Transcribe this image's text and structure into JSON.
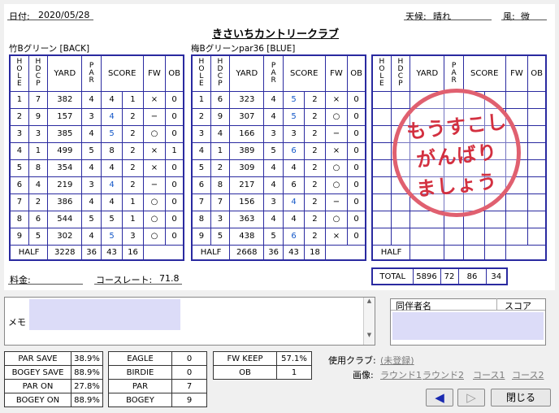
{
  "header": {
    "date_label": "日付:",
    "date_value": "2020/05/28",
    "title": "きさいちカントリークラブ",
    "weather_label": "天候:",
    "weather_value": "晴れ",
    "wind_label": "風:",
    "wind_value": "微"
  },
  "columns": {
    "hole": "HOLE",
    "hdcp": "HDCP",
    "yard": "YARD",
    "par": "PAR",
    "score": "SCORE",
    "fw": "FW",
    "ob": "OB"
  },
  "course1": {
    "name": "竹Bグリーン [BACK]",
    "rows": [
      {
        "hole": "1",
        "hdcp": "7",
        "yard": "382",
        "par": "4",
        "score": "4",
        "putt": "1",
        "fw": "×",
        "ob": "0",
        "style": ""
      },
      {
        "hole": "2",
        "hdcp": "9",
        "yard": "157",
        "par": "3",
        "score": "4",
        "putt": "2",
        "fw": "−",
        "ob": "0",
        "style": "blue"
      },
      {
        "hole": "3",
        "hdcp": "3",
        "yard": "385",
        "par": "4",
        "score": "5",
        "putt": "2",
        "fw": "○",
        "ob": "0",
        "style": "blue"
      },
      {
        "hole": "4",
        "hdcp": "1",
        "yard": "499",
        "par": "5",
        "score": "8",
        "putt": "2",
        "fw": "×",
        "ob": "1",
        "style": "bold"
      },
      {
        "hole": "5",
        "hdcp": "8",
        "yard": "354",
        "par": "4",
        "score": "4",
        "putt": "2",
        "fw": "×",
        "ob": "0",
        "style": ""
      },
      {
        "hole": "6",
        "hdcp": "4",
        "yard": "219",
        "par": "3",
        "score": "4",
        "putt": "2",
        "fw": "−",
        "ob": "0",
        "style": "blue"
      },
      {
        "hole": "7",
        "hdcp": "2",
        "yard": "386",
        "par": "4",
        "score": "4",
        "putt": "1",
        "fw": "○",
        "ob": "0",
        "style": ""
      },
      {
        "hole": "8",
        "hdcp": "6",
        "yard": "544",
        "par": "5",
        "score": "5",
        "putt": "1",
        "fw": "○",
        "ob": "0",
        "style": ""
      },
      {
        "hole": "9",
        "hdcp": "5",
        "yard": "302",
        "par": "4",
        "score": "5",
        "putt": "3",
        "fw": "○",
        "ob": "0",
        "style": "blue"
      }
    ],
    "half": {
      "label": "HALF",
      "yard": "3228",
      "par": "36",
      "score": "43",
      "putt": "16"
    }
  },
  "course2": {
    "name": "梅Bグリーンpar36 [BLUE]",
    "rows": [
      {
        "hole": "1",
        "hdcp": "6",
        "yard": "323",
        "par": "4",
        "score": "5",
        "putt": "2",
        "fw": "×",
        "ob": "0",
        "style": "blue"
      },
      {
        "hole": "2",
        "hdcp": "9",
        "yard": "307",
        "par": "4",
        "score": "5",
        "putt": "2",
        "fw": "○",
        "ob": "0",
        "style": "blue"
      },
      {
        "hole": "3",
        "hdcp": "4",
        "yard": "166",
        "par": "3",
        "score": "3",
        "putt": "2",
        "fw": "−",
        "ob": "0",
        "style": ""
      },
      {
        "hole": "4",
        "hdcp": "1",
        "yard": "389",
        "par": "5",
        "score": "6",
        "putt": "2",
        "fw": "×",
        "ob": "0",
        "style": "blue"
      },
      {
        "hole": "5",
        "hdcp": "2",
        "yard": "309",
        "par": "4",
        "score": "4",
        "putt": "2",
        "fw": "○",
        "ob": "0",
        "style": ""
      },
      {
        "hole": "6",
        "hdcp": "8",
        "yard": "217",
        "par": "4",
        "score": "6",
        "putt": "2",
        "fw": "○",
        "ob": "0",
        "style": "bold"
      },
      {
        "hole": "7",
        "hdcp": "7",
        "yard": "156",
        "par": "3",
        "score": "4",
        "putt": "2",
        "fw": "−",
        "ob": "0",
        "style": "blue"
      },
      {
        "hole": "8",
        "hdcp": "3",
        "yard": "363",
        "par": "4",
        "score": "4",
        "putt": "2",
        "fw": "○",
        "ob": "0",
        "style": ""
      },
      {
        "hole": "9",
        "hdcp": "5",
        "yard": "438",
        "par": "5",
        "score": "6",
        "putt": "2",
        "fw": "×",
        "ob": "0",
        "style": "blue"
      }
    ],
    "half": {
      "label": "HALF",
      "yard": "2668",
      "par": "36",
      "score": "43",
      "putt": "18"
    }
  },
  "course3": {
    "half_label": "HALF",
    "total_label": "TOTAL",
    "total": {
      "yard": "5896",
      "par": "72",
      "score": "86",
      "putt": "34"
    }
  },
  "stamp": {
    "line1": "もうすこし",
    "line2": "がんばり",
    "line3": "ましょう",
    "color": "#d33040"
  },
  "fee_label": "料金:",
  "course_rate_label": "コースレート:",
  "course_rate_value": "71.8",
  "memo_label": "メモ",
  "companions": {
    "col_name": "同伴者名",
    "col_score": "スコア"
  },
  "stats1": [
    {
      "label": "PAR SAVE",
      "value": "38.9%"
    },
    {
      "label": "BOGEY SAVE",
      "value": "88.9%"
    },
    {
      "label": "PAR ON",
      "value": "27.8%"
    },
    {
      "label": "BOGEY ON",
      "value": "88.9%"
    }
  ],
  "stats2": [
    {
      "label": "EAGLE",
      "value": "0"
    },
    {
      "label": "BIRDIE",
      "value": "0"
    },
    {
      "label": "PAR",
      "value": "7"
    },
    {
      "label": "BOGEY",
      "value": "9"
    }
  ],
  "stats3": [
    {
      "label": "FW KEEP",
      "value": "57.1%"
    },
    {
      "label": "OB",
      "value": "1"
    }
  ],
  "club_label": "使用クラブ:",
  "club_link": "(未登録)",
  "image_label": "画像:",
  "image_links": [
    "ラウンド1",
    "ラウンド2",
    "コース1",
    "コース2"
  ],
  "nav": {
    "back_icon": "◀",
    "forward_icon": "▷",
    "close_label": "閉じる"
  },
  "colors": {
    "grid": "#2a2aa0",
    "highlight": "#dcdcf8",
    "accent": "#1458c8"
  }
}
